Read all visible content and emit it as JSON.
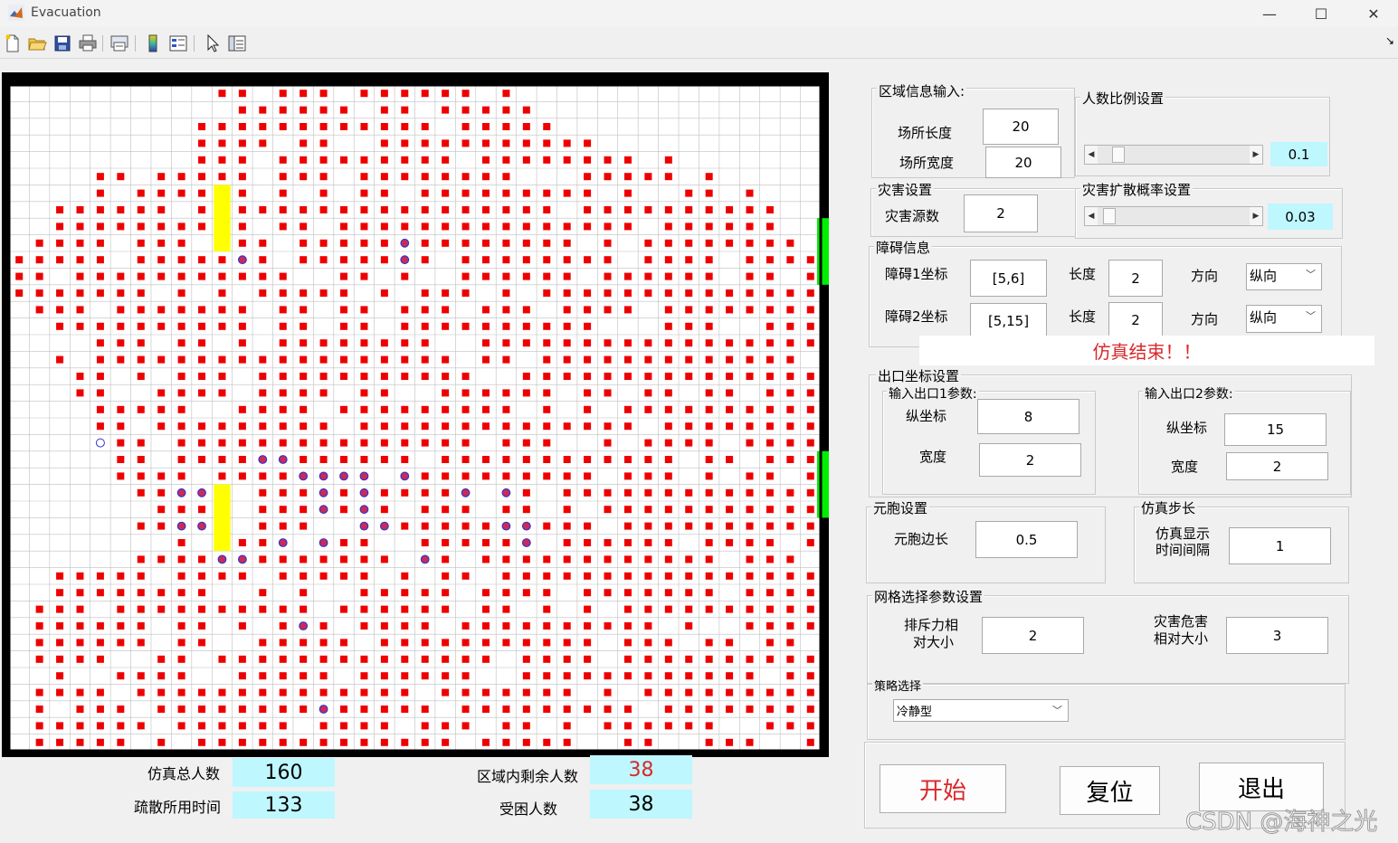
{
  "window": {
    "title": "Evacuation",
    "min_symbol": "—",
    "max_symbol": "☐",
    "close_symbol": "✕"
  },
  "toolbar": {
    "icons": [
      "new-file-icon",
      "open-folder-icon",
      "save-icon",
      "print-icon",
      "print-figure-icon",
      "colorbar-icon",
      "legend-icon",
      "pointer-icon",
      "property-inspector-icon"
    ]
  },
  "grid": {
    "cells": 40,
    "colors": {
      "grid_line": "#bfbfbf",
      "person": "#ee0000",
      "person_marked_fill": "#cc2a55",
      "person_marked_edge": "#3333cc",
      "obstacle": "#ffff00",
      "exit": "#00ee00",
      "frame": "#000000"
    }
  },
  "area_panel": {
    "title": "区域信息输入:",
    "length_label": "场所长度",
    "length_value": "20",
    "width_label": "场所宽度",
    "width_value": "20"
  },
  "ratio_panel": {
    "title": "人数比例设置",
    "value": "0.1",
    "slider_fraction": 0.1
  },
  "disaster_panel": {
    "title": "灾害设置",
    "sources_label": "灾害源数",
    "sources_value": "2"
  },
  "spread_panel": {
    "title": "灾害扩散概率设置",
    "value": "0.03",
    "slider_fraction": 0.03
  },
  "obstacle_panel": {
    "title": "障碍信息",
    "rows": [
      {
        "coord_label": "障碍1坐标",
        "coord_value": "[5,6]",
        "length_label": "长度",
        "length_value": "2",
        "dir_label": "方向",
        "dir_value": "纵向"
      },
      {
        "coord_label": "障碍2坐标",
        "coord_value": "[5,15]",
        "length_label": "长度",
        "length_value": "2",
        "dir_label": "方向",
        "dir_value": "纵向"
      }
    ]
  },
  "status_text": "仿真结束！！",
  "exit_panel": {
    "title": "出口坐标设置",
    "exit1": {
      "title": "输入出口1参数:",
      "y_label": "纵坐标",
      "y_value": "8",
      "w_label": "宽度",
      "w_value": "2"
    },
    "exit2": {
      "title": "输入出口2参数:",
      "y_label": "纵坐标",
      "y_value": "15",
      "w_label": "宽度",
      "w_value": "2"
    }
  },
  "cell_panel": {
    "title": "元胞设置",
    "side_label": "元胞边长",
    "side_value": "0.5"
  },
  "step_panel": {
    "title": "仿真步长",
    "interval_label_1": "仿真显示",
    "interval_label_2": "时间间隔",
    "interval_value": "1"
  },
  "grid_panel": {
    "title": "网格选择参数设置",
    "repulse_label_1": "排斥力相",
    "repulse_label_2": "对大小",
    "repulse_value": "2",
    "hazard_label_1": "灾害危害",
    "hazard_label_2": "相对大小",
    "hazard_value": "3"
  },
  "strategy": {
    "title": "策略选择",
    "value": "冷静型"
  },
  "buttons": {
    "start": "开始",
    "reset": "复位",
    "exit": "退出"
  },
  "stats": {
    "total_label": "仿真总人数",
    "total_value": "160",
    "time_label": "疏散所用时间",
    "time_value": "133",
    "remain_label": "区域内剩余人数",
    "remain_value": "38",
    "trapped_label": "受困人数",
    "trapped_value": "38"
  },
  "watermark": "CSDN @海神之光"
}
